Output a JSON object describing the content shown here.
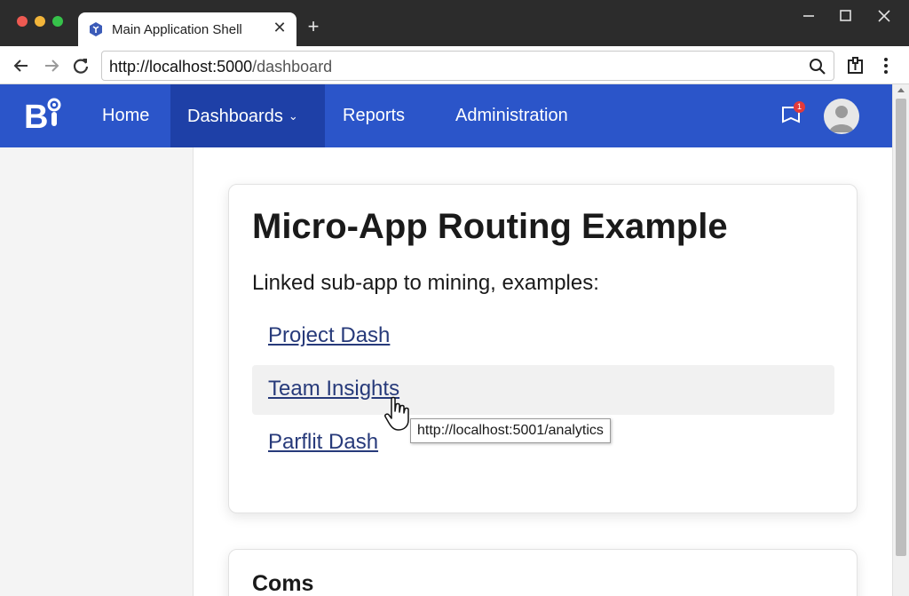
{
  "browser": {
    "tab_title": "Main Application Shell",
    "new_tab_glyph": "+",
    "close_glyph": "✕",
    "url_host": "http://localhost:5000",
    "url_path": "/dashboard"
  },
  "app": {
    "logo_text": "B",
    "nav": {
      "home": "Home",
      "dashboards": "Dashboards",
      "dashboards_chevron": "⌄",
      "reports": "Reports",
      "administration": "Administration"
    },
    "notifications_count": "1"
  },
  "main": {
    "title": "Micro-App Routing Example",
    "subtitle": "Linked sub-app to mining, examples:",
    "links": [
      {
        "label": "Project Dash"
      },
      {
        "label": "Team Insights"
      },
      {
        "label": "Parflit Dash"
      }
    ],
    "tooltip": "http://localhost:5001/analytics",
    "section2_title": "Coms"
  },
  "colors": {
    "nav_bg": "#2b55c9",
    "nav_active_bg": "#1e40a7",
    "link": "#273a7a",
    "badge": "#e23a3a"
  },
  "icons": [
    "app-favicon-icon",
    "close-icon",
    "plus-icon",
    "minimize-icon",
    "maximize-icon",
    "window-close-icon",
    "back-icon",
    "forward-icon",
    "reload-icon",
    "search-icon",
    "extensions-icon",
    "kebab-menu-icon",
    "notification-icon",
    "user-avatar-icon",
    "hand-cursor-icon"
  ]
}
